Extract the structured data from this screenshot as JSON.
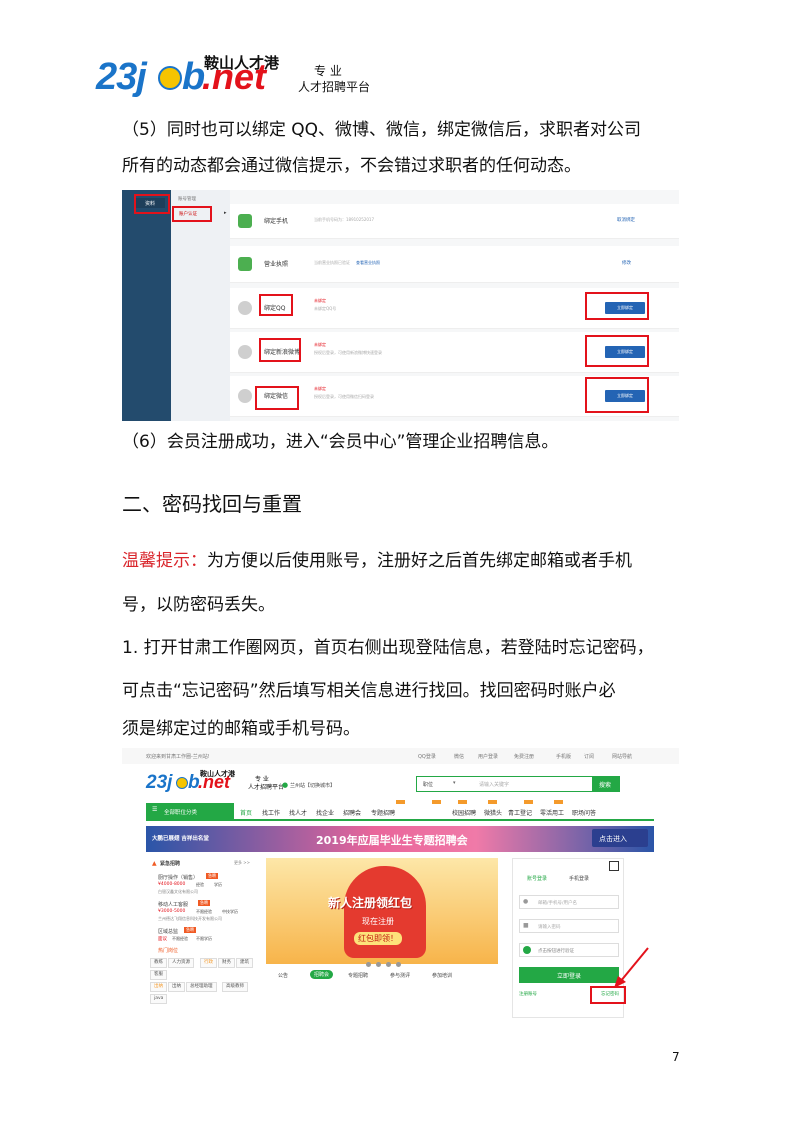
{
  "header": {
    "logo_number": "23j",
    "logo_mid": "b",
    "logo_net": ".net",
    "logo_cn": "鞍山人才港",
    "tagline_1": "专 业",
    "tagline_2": "人才招聘平台"
  },
  "para1_line1": "（5）同时也可以绑定 QQ、微博、微信，绑定微信后，求职者对公司",
  "para1_line2": "所有的动态都会通过微信提示，不会错过求职者的任何动态。",
  "shot1": {
    "sidebar_label": "资料",
    "sub_title": "账号管理",
    "sub_item": "账户认证",
    "rows": [
      {
        "title": "绑定手机",
        "desc": "当前手机号码为：18910252017",
        "action": "取消绑定"
      },
      {
        "title": "营业执照",
        "desc": "当前营业执照已验证",
        "extra": "查看营业执照",
        "action": "修改"
      },
      {
        "title": "绑定QQ",
        "status": "未绑定",
        "desc": "未绑定QQ号",
        "action": "立即绑定"
      },
      {
        "title": "绑定新浪微博",
        "status": "未绑定",
        "desc": "授权后登录，可使用新浪微博快速登录",
        "action": "立即绑定"
      },
      {
        "title": "绑定微信",
        "status": "未绑定",
        "desc": "授权后登录，可使用微信扫码登录",
        "action": "立即绑定"
      }
    ]
  },
  "para2": "（6）会员注册成功，进入“会员中心”管理企业招聘信息。",
  "heading2": "二、密码找回与重置",
  "tip_label": "温馨提示：",
  "tip_line1": "为方便以后使用账号，注册好之后首先绑定邮箱或者手机",
  "tip_line2": "号，以防密码丢失。",
  "step1_line1": "1. 打开甘肃工作圈网页，首页右侧出现登陆信息，若登陆时忘记密码，",
  "step1_line2": "可点击“忘记密码”然后填写相关信息进行找回。找回密码时账户必",
  "step1_line3": "须是绑定过的邮箱或手机号码。",
  "shot2": {
    "welcome": "欢迎来到甘肃工作圈-兰州站!",
    "top_links": [
      "QQ登录",
      "微信",
      "用户登录",
      "免费注册",
      "手机版",
      "订阅",
      "网站导航"
    ],
    "city": "兰州站【切换城市】",
    "search_type": "职位",
    "search_placeholder": "请输入关键字",
    "search_button": "搜索",
    "category": "全部职位分类",
    "nav": [
      "首页",
      "找工作",
      "找人才",
      "找企业",
      "招聘会",
      "专题招聘",
      "校园招聘",
      "微猎头",
      "青工登记",
      "零活用工",
      "职场问答"
    ],
    "banner_left": "大鹏已展翅 吉祥出名堂",
    "banner_title": "2019年应届毕业生专题招聘会",
    "banner_button": "点击进入",
    "urgent_title": "紧急招聘",
    "more": "更多 >>",
    "jobs": [
      {
        "title": "厨厅操作（销售）",
        "badge": "急聘",
        "salary": "¥4000-8000",
        "exp": "经验",
        "edu": "学历",
        "company": "白银汉鑫文化有限公司"
      },
      {
        "title": "移动人工客服",
        "badge": "急聘",
        "salary": "¥3000-5000",
        "exp": "不限经验",
        "edu": "中技学历",
        "company": "兰州德达飞翔信息科技开发有限公司"
      },
      {
        "title": "区域总监",
        "badge": "急聘",
        "salary": "面议",
        "exp": "不限经验",
        "edu": "不限学历",
        "company": ""
      }
    ],
    "hot_title": "热门岗位",
    "hot_tags": [
      "教练",
      "人力资源",
      "行政",
      "财务",
      "建筑",
      "客服",
      "出纳",
      "出纳",
      "总经理助理",
      "高级教师",
      "java"
    ],
    "promo_title": "新人注册领红包",
    "promo_sub": "现在注册",
    "promo_btn": "红包即领！",
    "tabs": [
      "公告",
      "招聘会",
      "专题招聘",
      "参与测评",
      "参加培训"
    ],
    "login_tabs": [
      "账号登录",
      "手机登录"
    ],
    "login_user_ph": "邮箱/手机号/用户名",
    "login_pass_ph": "请输入密码",
    "captcha": "点击按钮进行验证",
    "login_button": "立即登录",
    "register_link": "注册账号",
    "forgot_link": "忘记密码"
  },
  "page_number": "7",
  "colors": {
    "brand_green": "#23a845",
    "highlight_red": "#e3121b",
    "sidebar_navy": "#234b6d",
    "bind_blue": "#2464b4"
  }
}
